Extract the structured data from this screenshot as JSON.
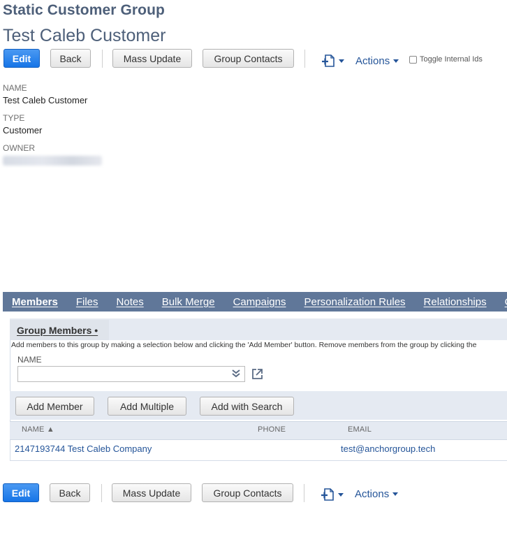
{
  "record": {
    "type_title": "Static Customer Group",
    "name_title": "Test Caleb Customer"
  },
  "toolbar": {
    "edit": "Edit",
    "back": "Back",
    "mass_update": "Mass Update",
    "group_contacts": "Group Contacts",
    "actions": "Actions",
    "toggle_internal_ids": "Toggle Internal Ids"
  },
  "fields": {
    "name_label": "NAME",
    "name_value": "Test Caleb Customer",
    "type_label": "TYPE",
    "type_value": "Customer",
    "owner_label": "OWNER"
  },
  "tabs": [
    "Members",
    "Files",
    "Notes",
    "Bulk Merge",
    "Campaigns",
    "Personalization Rules",
    "Relationships",
    "Custom"
  ],
  "members": {
    "subtab": "Group Members •",
    "help": "Add members to this group by making a selection below and clicking the 'Add Member' button. Remove members from the group by clicking the",
    "name_label": "NAME",
    "add_member": "Add Member",
    "add_multiple": "Add Multiple",
    "add_with_search": "Add with Search",
    "columns": {
      "name": "NAME ▲",
      "phone": "PHONE",
      "email": "EMAIL"
    },
    "rows": [
      {
        "name": "2147193744 Test Caleb Company",
        "phone": "",
        "email": "test@anchorgroup.tech"
      }
    ]
  },
  "icons": [
    "new-document-icon",
    "double-chevron-down-icon",
    "open-external-icon",
    "caret-down-icon"
  ],
  "colors": {
    "primary": "#1775e7",
    "title": "#4d5f79",
    "tabbar": "#607799",
    "link": "#255599"
  }
}
